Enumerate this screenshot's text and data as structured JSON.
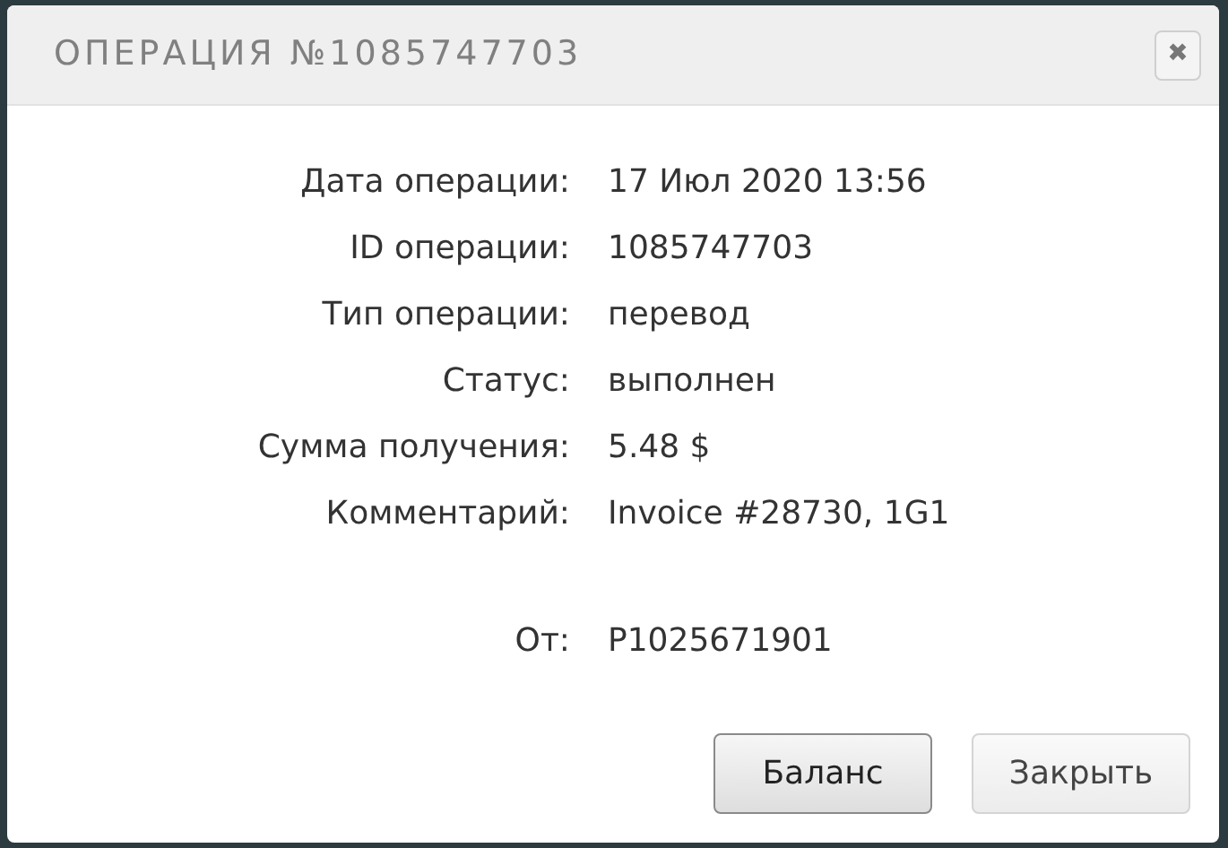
{
  "dialog": {
    "title": "ОПЕРАЦИЯ №1085747703",
    "close_icon": "✖"
  },
  "fields": [
    {
      "label": "Дата операции:",
      "value": "17 Июл 2020 13:56"
    },
    {
      "label": "ID операции:",
      "value": "1085747703"
    },
    {
      "label": "Тип операции:",
      "value": "перевод"
    },
    {
      "label": "Статус:",
      "value": "выполнен"
    },
    {
      "label": "Сумма получения:",
      "value": "5.48 $"
    },
    {
      "label": "Комментарий:",
      "value": "Invoice #28730, 1G1"
    }
  ],
  "sender": {
    "label": "От:",
    "value": "P1025671901"
  },
  "buttons": [
    {
      "label": "Баланс",
      "focused": true
    },
    {
      "label": "Закрыть",
      "focused": false
    }
  ]
}
